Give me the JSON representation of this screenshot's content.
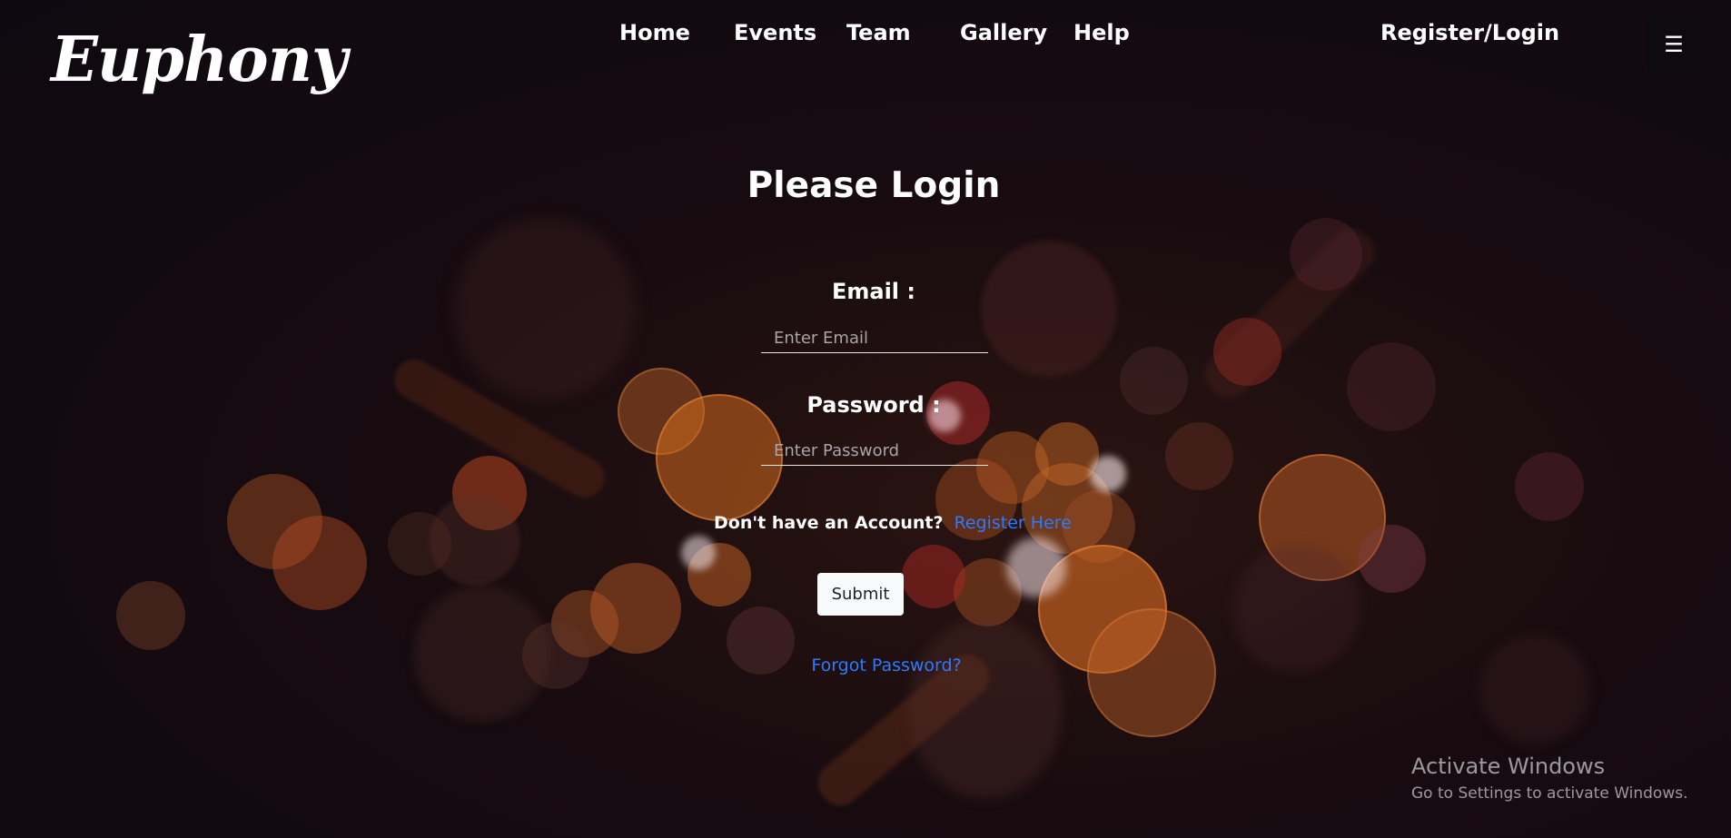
{
  "brand": {
    "logo_text": "Euphony"
  },
  "nav": {
    "items": [
      {
        "label": "Home"
      },
      {
        "label": "Events"
      },
      {
        "label": "Team"
      },
      {
        "label": "Gallery"
      },
      {
        "label": "Help"
      }
    ],
    "auth_label": "Register/Login",
    "menu_icon": "hamburger-icon",
    "menu_glyph": "☰"
  },
  "login": {
    "title": "Please Login",
    "email_label": "Email :",
    "email_placeholder": "Enter Email",
    "email_value": "",
    "password_label": "Password :",
    "password_placeholder": "Enter Password",
    "password_value": "",
    "no_account_text": "Don't have an Account?",
    "register_link": "Register Here",
    "submit_label": "Submit",
    "forgot_link": "Forgot Password?"
  },
  "watermark": {
    "title": "Activate Windows",
    "subtitle": "Go to Settings to activate Windows."
  },
  "colors": {
    "background": "#140b0f",
    "link": "#2b7bff",
    "text": "#ffffff",
    "bokeh_orange": "#c0661e"
  }
}
